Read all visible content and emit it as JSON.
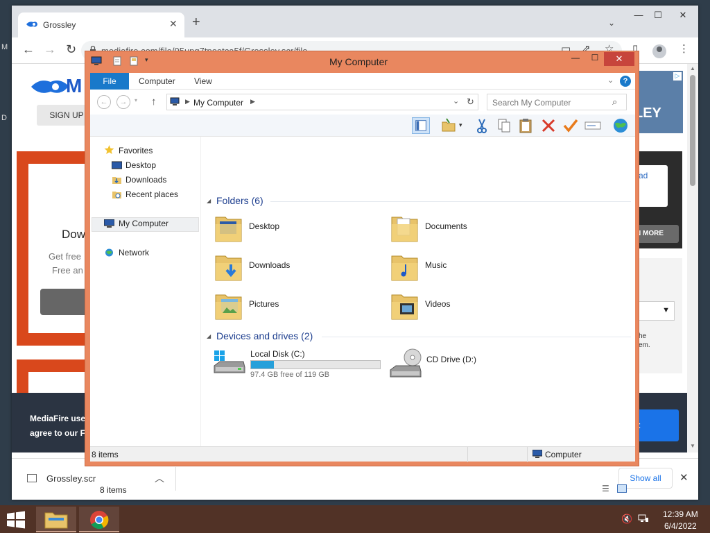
{
  "browser": {
    "tab_title": "Grossley",
    "tab_close": "✕",
    "new_tab": "+",
    "url": "mediafire.com/file/95upq7tpoetca5f/Grossley.scr/file",
    "window_controls": {
      "minimize": "—",
      "maximize": "☐",
      "close": "✕"
    }
  },
  "page": {
    "logo_text": "M",
    "signup": "SIGN UP",
    "ad_banner_text": "LEY",
    "card_heading": "Dow",
    "card_line1": "Get free",
    "card_line2": "Free an",
    "right_card_text": "ad",
    "learn_more": "N MORE",
    "right_text": "he\nem.",
    "cookie_line1": "MediaFire use",
    "cookie_line2": "agree to our F",
    "accept_label": "nt"
  },
  "download_bar": {
    "filename": "Grossley.scr",
    "show_all": "Show all",
    "close": "✕"
  },
  "explorer": {
    "title": "My Computer",
    "controls": {
      "minimize": "—",
      "maximize": "☐",
      "close": "✕"
    },
    "ribbon_tabs": [
      "File",
      "Computer",
      "View"
    ],
    "help": "?",
    "breadcrumb": "My Computer",
    "search_placeholder": "Search My Computer",
    "nav": {
      "favorites": "Favorites",
      "desktop": "Desktop",
      "downloads": "Downloads",
      "recent": "Recent places",
      "my_computer": "My Computer",
      "network": "Network"
    },
    "folders_header": "Folders (6)",
    "folders": [
      {
        "name": "Desktop"
      },
      {
        "name": "Documents"
      },
      {
        "name": "Downloads"
      },
      {
        "name": "Music"
      },
      {
        "name": "Pictures"
      },
      {
        "name": "Videos"
      }
    ],
    "drives_header": "Devices and drives (2)",
    "drives": [
      {
        "name": "Local Disk (C:)",
        "free_text": "97.4 GB free of 119 GB",
        "used_fraction": 0.18
      },
      {
        "name": "CD Drive (D:)"
      }
    ],
    "item_count": "8 items",
    "status_left": "8 items",
    "status_right": "Computer"
  },
  "taskbar": {
    "time": "12:39 AM",
    "date": "6/4/2022"
  },
  "colors": {
    "explorer_frame": "#e9875f",
    "accent_blue": "#1979ca",
    "taskbar": "#513226",
    "close_red": "#c7453c"
  }
}
